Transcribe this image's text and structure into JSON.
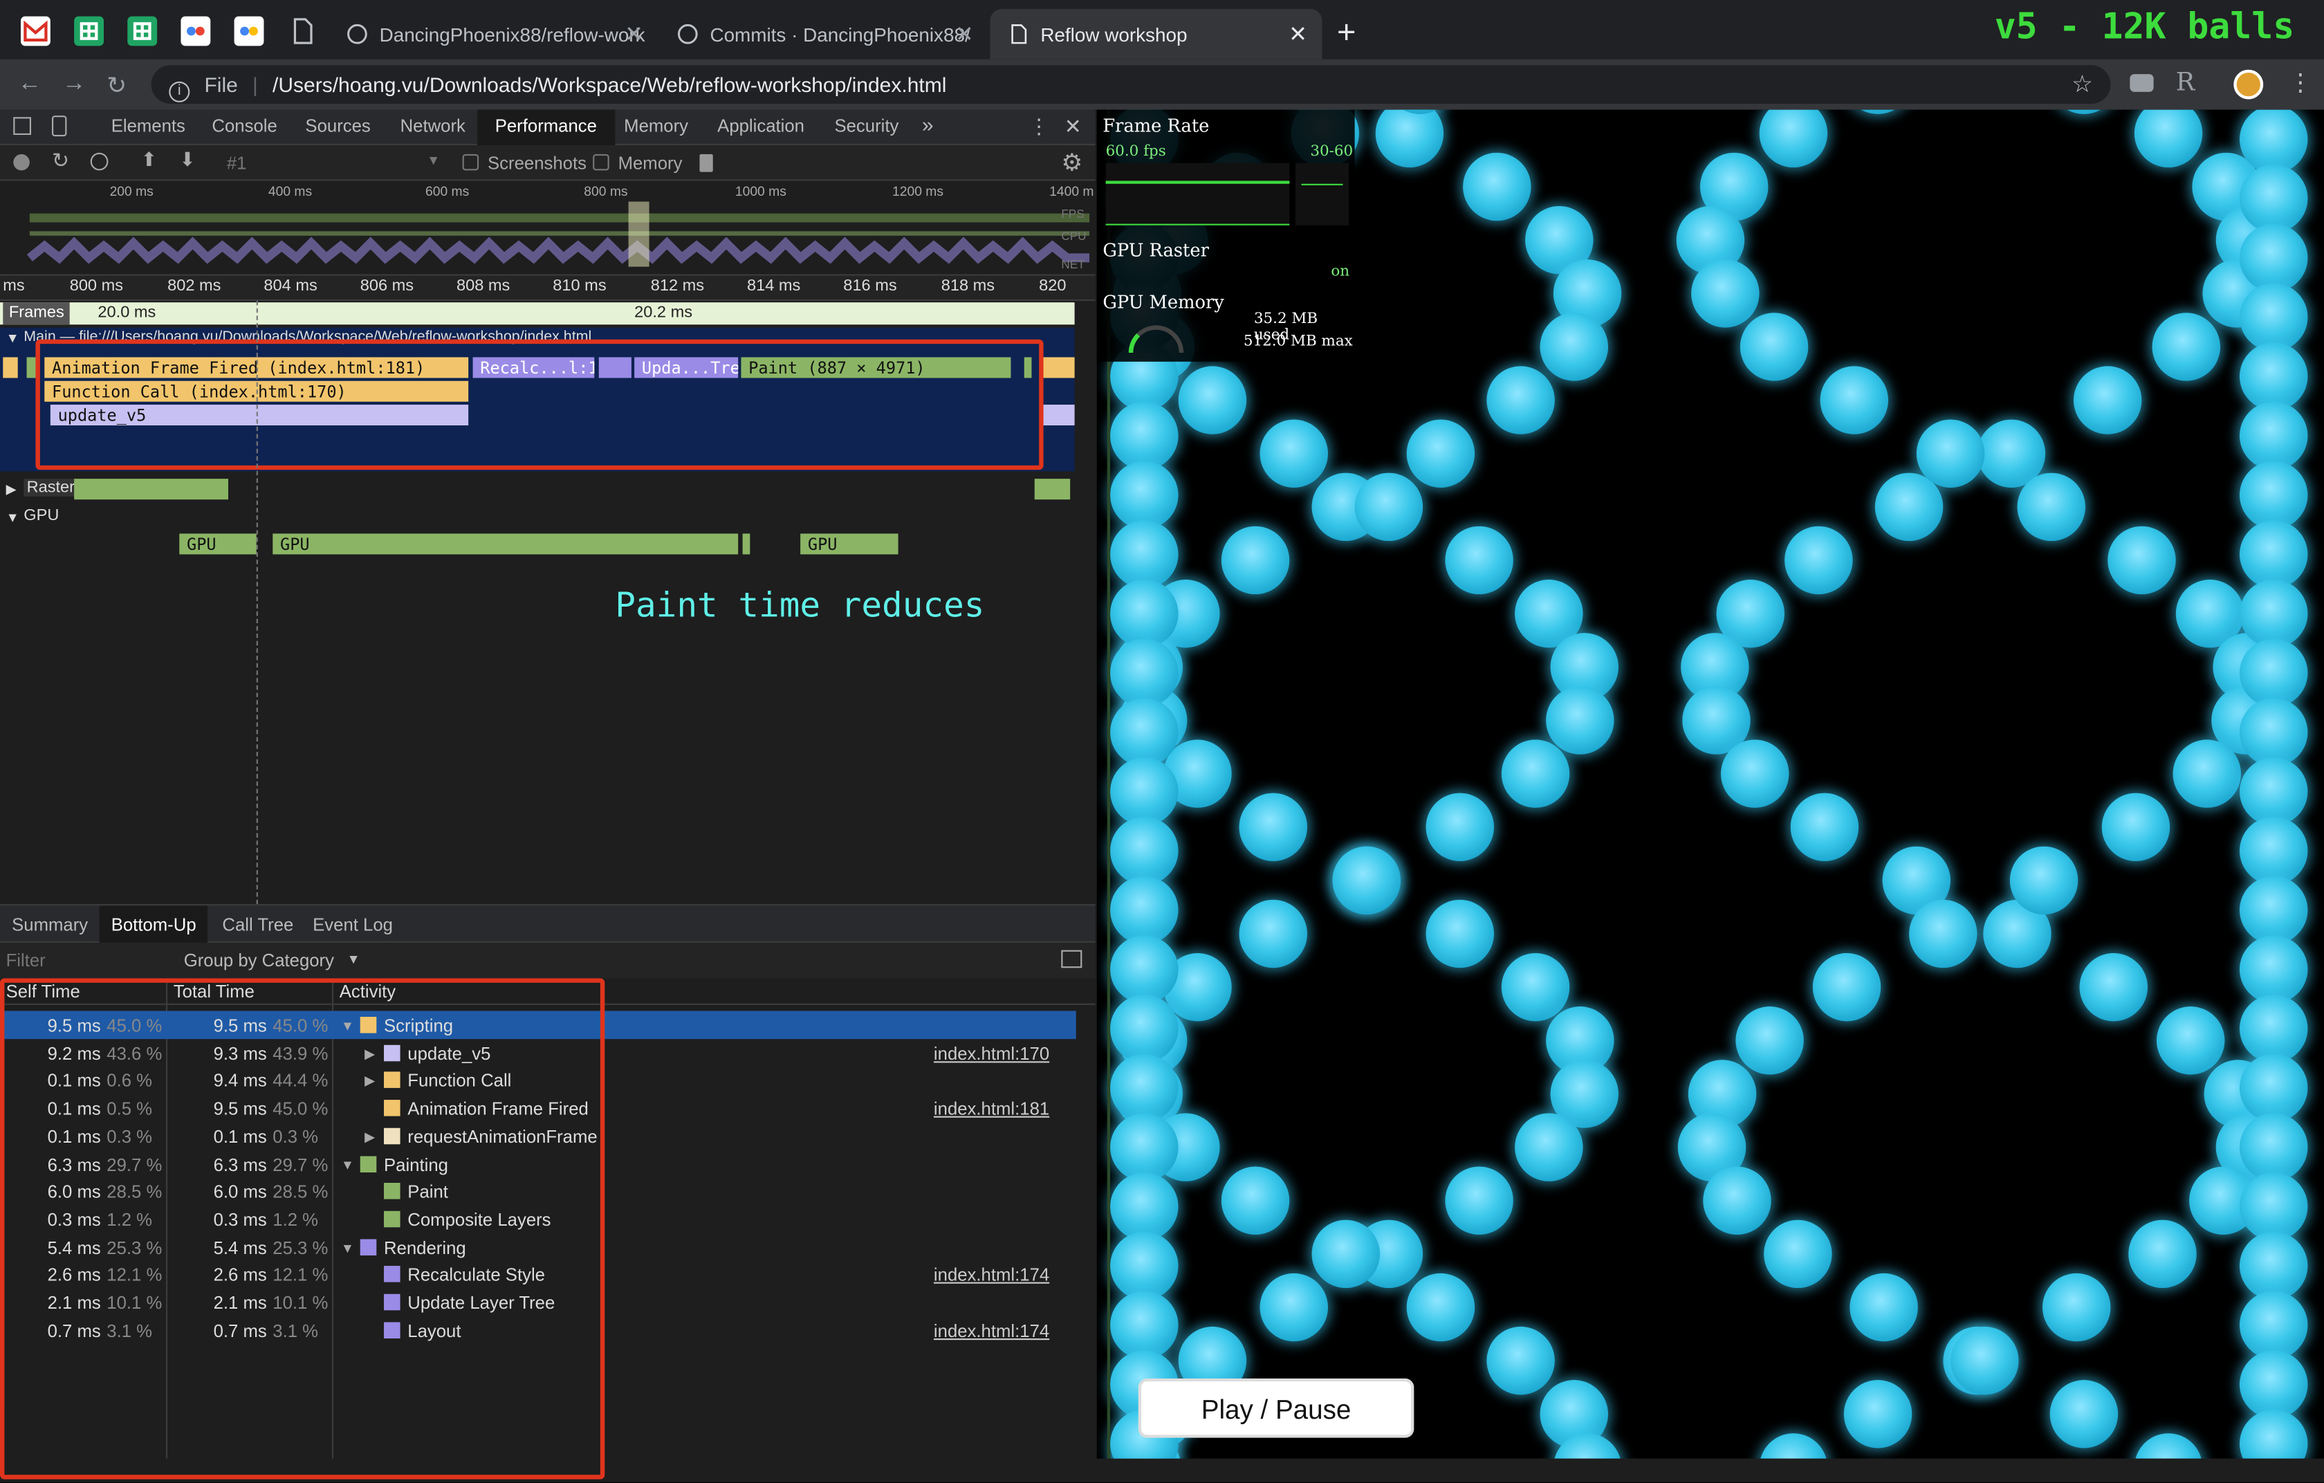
{
  "browser": {
    "tabs": [
      {
        "label": "DancingPhoenix88/reflow-work"
      },
      {
        "label": "Commits · DancingPhoenix88/"
      },
      {
        "label": "Reflow workshop"
      }
    ],
    "scheme": "File",
    "url": "/Users/hoang.vu/Downloads/Workspace/Web/reflow-workshop/index.html",
    "overlay_title": "v5 - 12K balls"
  },
  "devtools": {
    "tabs": [
      "Elements",
      "Console",
      "Sources",
      "Network",
      "Performance",
      "Memory",
      "Application",
      "Security"
    ],
    "more": "»",
    "perf_toolbar": {
      "record": "#1",
      "screenshots": "Screenshots",
      "memory": "Memory"
    },
    "overview_ticks": [
      "200 ms",
      "400 ms",
      "600 ms",
      "800 ms",
      "1000 ms",
      "1200 ms",
      "1400 m"
    ],
    "overview_lanes": [
      "FPS",
      "CPU",
      "NET"
    ],
    "ruler_ticks": [
      "ms",
      "800 ms",
      "802 ms",
      "804 ms",
      "806 ms",
      "808 ms",
      "810 ms",
      "812 ms",
      "814 ms",
      "816 ms",
      "818 ms",
      "820"
    ],
    "frames": {
      "label": "Frames",
      "f1": "20.0 ms",
      "f2": "20.2 ms"
    },
    "main_label": "Main — file:///Users/hoang.vu/Downloads/Workspace/Web/reflow-workshop/index.html",
    "flame": {
      "afr": "Animation Frame Fired (index.html:181)",
      "fcall": "Function Call (index.html:170)",
      "update": "update_v5",
      "recalc": "Recalc...l:174)",
      "uplayer": "Upda...Tree",
      "paint": "Paint (887 × 4971)"
    },
    "raster": "Raster",
    "gpu": "GPU",
    "gpu_blocks": [
      "GPU",
      "GPU",
      "GPU"
    ],
    "annotation": "Paint time reduces",
    "bottom_tabs": [
      "Summary",
      "Bottom-Up",
      "Call Tree",
      "Event Log"
    ],
    "filter_placeholder": "Filter",
    "group_by": "Group by Category",
    "columns": [
      "Self Time",
      "Total Time",
      "Activity"
    ],
    "rows": [
      {
        "self": "9.5 ms",
        "self_pct": "45.0 %",
        "total": "9.5 ms",
        "total_pct": "45.0 %",
        "activity": "Scripting",
        "color": "#f2c56c",
        "link": "",
        "level": 0,
        "arrow": "▼",
        "selected": true
      },
      {
        "self": "9.2 ms",
        "self_pct": "43.6 %",
        "total": "9.3 ms",
        "total_pct": "43.9 %",
        "activity": "update_v5",
        "color": "#c7c0f2",
        "link": "index.html:170",
        "level": 1,
        "arrow": "▶",
        "selected": false
      },
      {
        "self": "0.1 ms",
        "self_pct": "0.6 %",
        "total": "9.4 ms",
        "total_pct": "44.4 %",
        "activity": "Function Call",
        "color": "#f2c56c",
        "link": "",
        "level": 1,
        "arrow": "▶",
        "selected": false
      },
      {
        "self": "0.1 ms",
        "self_pct": "0.5 %",
        "total": "9.5 ms",
        "total_pct": "45.0 %",
        "activity": "Animation Frame Fired",
        "color": "#f2c56c",
        "link": "index.html:181",
        "level": 1,
        "arrow": "",
        "selected": false
      },
      {
        "self": "0.1 ms",
        "self_pct": "0.3 %",
        "total": "0.1 ms",
        "total_pct": "0.3 %",
        "activity": "requestAnimationFrame",
        "color": "#f0e2c0",
        "link": "",
        "level": 1,
        "arrow": "▶",
        "selected": false
      },
      {
        "self": "6.3 ms",
        "self_pct": "29.7 %",
        "total": "6.3 ms",
        "total_pct": "29.7 %",
        "activity": "Painting",
        "color": "#8bb565",
        "link": "",
        "level": 0,
        "arrow": "▼",
        "selected": false
      },
      {
        "self": "6.0 ms",
        "self_pct": "28.5 %",
        "total": "6.0 ms",
        "total_pct": "28.5 %",
        "activity": "Paint",
        "color": "#8bb565",
        "link": "",
        "level": 1,
        "arrow": "",
        "selected": false
      },
      {
        "self": "0.3 ms",
        "self_pct": "1.2 %",
        "total": "0.3 ms",
        "total_pct": "1.2 %",
        "activity": "Composite Layers",
        "color": "#8bb565",
        "link": "",
        "level": 1,
        "arrow": "",
        "selected": false
      },
      {
        "self": "5.4 ms",
        "self_pct": "25.3 %",
        "total": "5.4 ms",
        "total_pct": "25.3 %",
        "activity": "Rendering",
        "color": "#9a8be6",
        "link": "",
        "level": 0,
        "arrow": "▼",
        "selected": false
      },
      {
        "self": "2.6 ms",
        "self_pct": "12.1 %",
        "total": "2.6 ms",
        "total_pct": "12.1 %",
        "activity": "Recalculate Style",
        "color": "#9a8be6",
        "link": "index.html:174",
        "level": 1,
        "arrow": "",
        "selected": false
      },
      {
        "self": "2.1 ms",
        "self_pct": "10.1 %",
        "total": "2.1 ms",
        "total_pct": "10.1 %",
        "activity": "Update Layer Tree",
        "color": "#9a8be6",
        "link": "",
        "level": 1,
        "arrow": "",
        "selected": false
      },
      {
        "self": "0.7 ms",
        "self_pct": "3.1 %",
        "total": "0.7 ms",
        "total_pct": "3.1 %",
        "activity": "Layout",
        "color": "#9a8be6",
        "link": "index.html:174",
        "level": 1,
        "arrow": "",
        "selected": false
      }
    ]
  },
  "hud": {
    "frame_rate_label": "Frame Rate",
    "fps": "60.0 fps",
    "range": "30-60",
    "gpu_raster_label": "GPU Raster",
    "gpu_raster_value": "on",
    "gpu_memory_label": "GPU Memory",
    "mem_used": "35.2 MB used",
    "mem_max": "512.0 MB max"
  },
  "play_button": "Play / Pause",
  "colors": {
    "ball": "#38c7ea",
    "annotation": "#5ff0e8",
    "overlay_title": "#3ddc3d",
    "highlight": "#e0341d"
  }
}
